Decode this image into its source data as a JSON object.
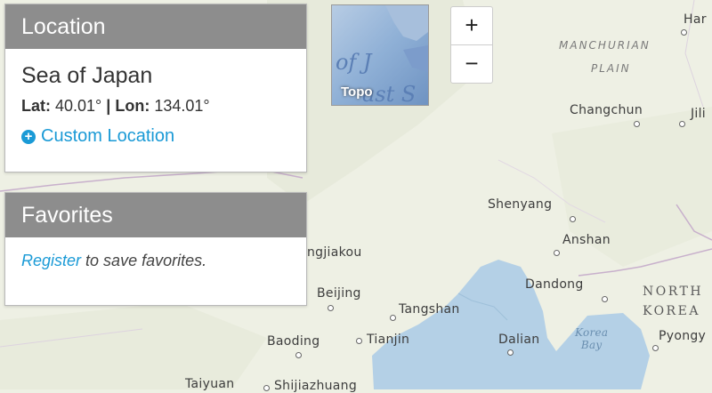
{
  "location": {
    "header": "Location",
    "name": "Sea of Japan",
    "lat_label": "Lat:",
    "lat_value": "40.01°",
    "separator": "|",
    "lon_label": "Lon:",
    "lon_value": "134.01°",
    "custom_location": "Custom Location"
  },
  "favorites": {
    "header": "Favorites",
    "register_link": "Register",
    "text": "to save favorites."
  },
  "basemap": {
    "label": "Topo",
    "thumb_text_1": "a of J",
    "thumb_text_2": "ast S"
  },
  "zoom": {
    "in": "+",
    "out": "−"
  },
  "map_labels": {
    "harbin": "Har",
    "manchurian": "MANCHURIAN",
    "plain": "PLAIN",
    "changchun": "Changchun",
    "jilin": "Jili",
    "shenyang": "Shenyang",
    "anshan": "Anshan",
    "zhangjiakou": "ngjiakou",
    "beijing": "Beijing",
    "tangshan": "Tangshan",
    "dandong": "Dandong",
    "north": "NORTH",
    "korea": "KOREA",
    "baoding": "Baoding",
    "tianjin": "Tianjin",
    "dalian": "Dalian",
    "korea_bay_1": "Korea",
    "korea_bay_2": "Bay",
    "pyongyang": "Pyongy",
    "taiyuan": "Taiyuan",
    "shijiazhuang": "Shijiazhuang"
  },
  "colors": {
    "land": "#eef0e4",
    "water": "#b4d0e6",
    "panel_header": "#8d8d8d",
    "link": "#1a9ad6"
  }
}
